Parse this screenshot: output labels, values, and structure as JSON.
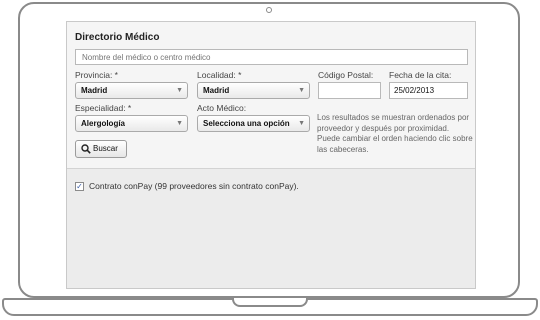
{
  "directory": {
    "title": "Directorio Médico",
    "search_placeholder": "Nombre del médico o centro médico",
    "provincia": {
      "label": "Provincia: *",
      "value": "Madrid"
    },
    "localidad": {
      "label": "Localidad: *",
      "value": "Madrid"
    },
    "codigo_postal": {
      "label": "Código Postal:",
      "value": ""
    },
    "fecha": {
      "label": "Fecha de la cita:",
      "value": "25/02/2013"
    },
    "especialidad": {
      "label": "Especialidad: *",
      "value": "Alergología"
    },
    "acto_medico": {
      "label": "Acto Médico:",
      "value": "Selecciona una opción"
    },
    "info_text": "Los resultados se muestran ordenados por proveedor y después por proximidad. Puede cambiar el orden haciendo clic sobre las cabeceras.",
    "search_button": "Buscar",
    "contrato": {
      "checked": true,
      "label": "Contrato conPay (99 proveedores sin contrato conPay)."
    }
  }
}
